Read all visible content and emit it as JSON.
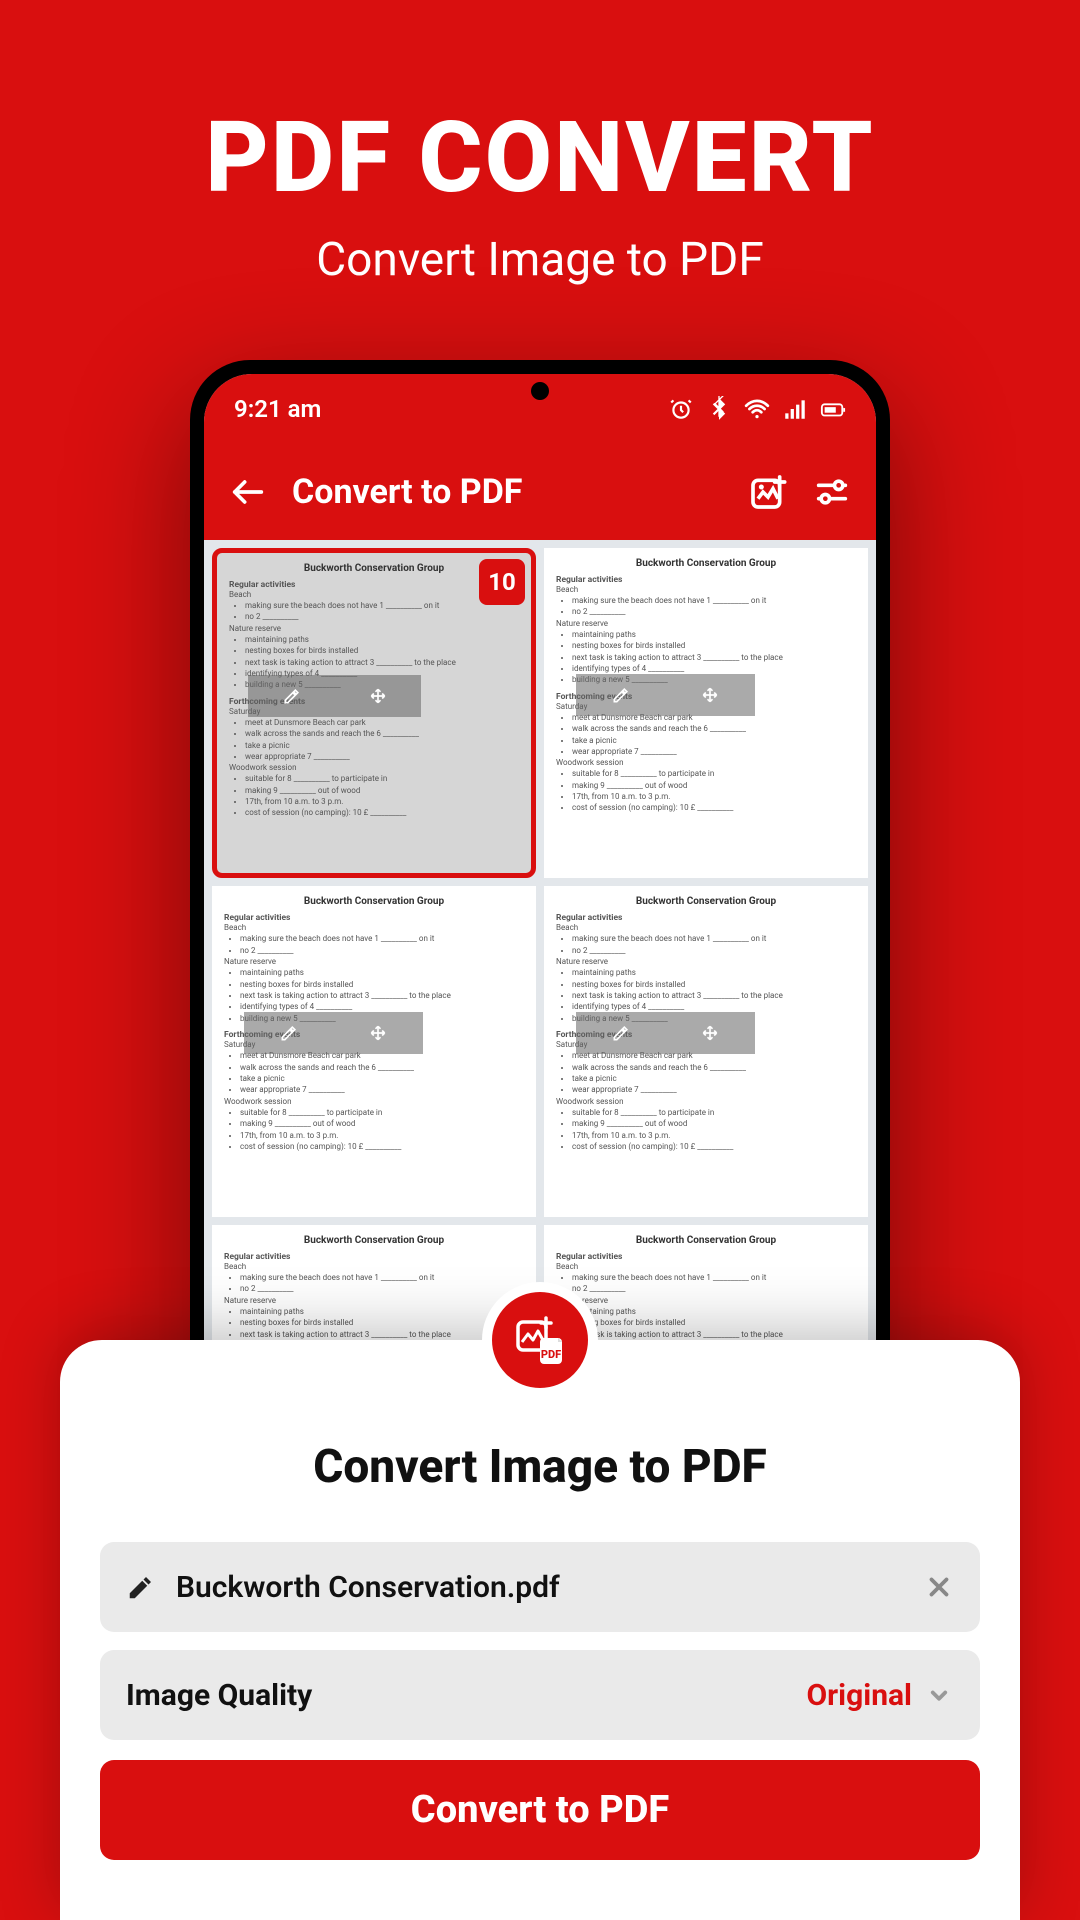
{
  "hero": {
    "title": "PDF CONVERT",
    "subtitle": "Convert Image to PDF"
  },
  "statusbar": {
    "time": "9:21 am"
  },
  "appbar": {
    "title": "Convert to PDF"
  },
  "thumbnails": {
    "selected_badge": "10",
    "doc_title": "Buckworth Conservation Group",
    "sections": {
      "regular": "Regular activities",
      "beach": "Beach",
      "nature": "Nature reserve",
      "forthcoming": "Forthcoming events",
      "saturday": "Saturday",
      "woodwork": "Woodwork session"
    },
    "lines": {
      "l1": "making sure the beach does not have 1 __________ on it",
      "l2": "no 2 __________",
      "l3": "maintaining paths",
      "l4": "nesting boxes for birds installed",
      "l5": "next task is taking action to attract 3 __________ to the place",
      "l6": "identifying types of 4 __________",
      "l7": "building a new 5 __________",
      "l8": "meet at Dunsmore Beach car park",
      "l9": "walk across the sands and reach the 6 __________",
      "l10": "take a picnic",
      "l11": "wear appropriate 7 __________",
      "l12": "suitable for 8 __________ to participate in",
      "l13": "making 9 __________ out of wood",
      "l14": "17th, from 10 a.m. to 3 p.m.",
      "l15": "cost of session (no camping): 10 £ __________"
    }
  },
  "sheet": {
    "title": "Convert Image to PDF",
    "filename": "Buckworth Conservation.pdf",
    "quality_label": "Image Quality",
    "quality_value": "Original",
    "button": "Convert to PDF"
  }
}
